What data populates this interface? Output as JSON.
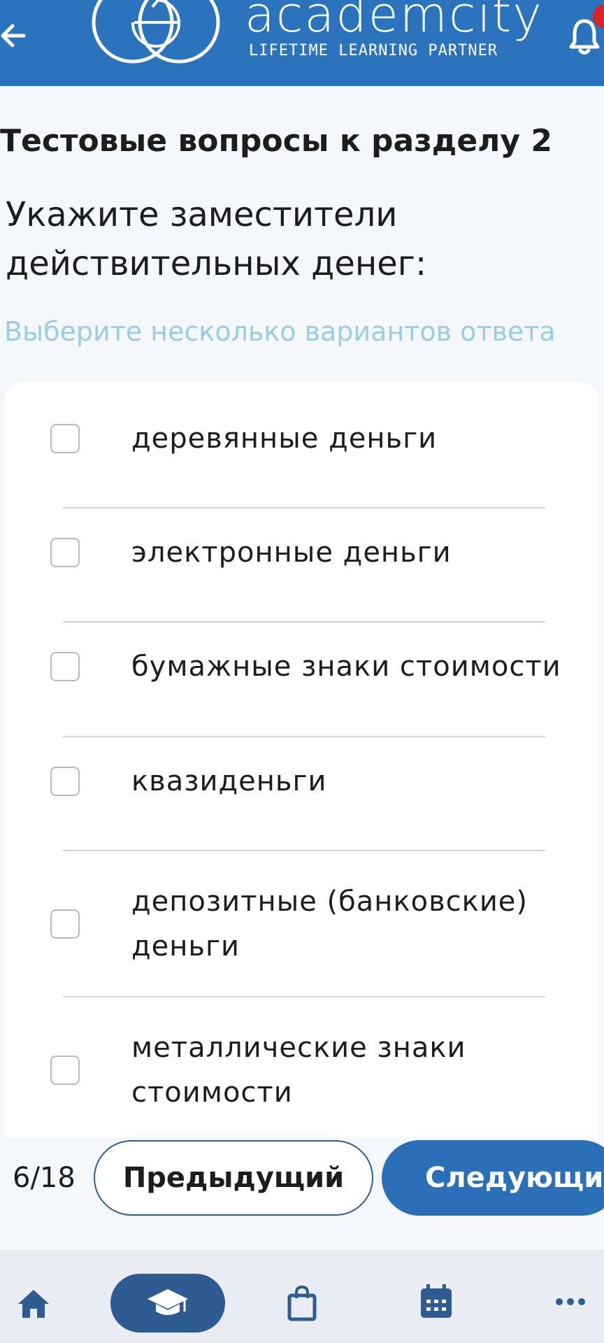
{
  "header": {
    "brand": "academcity",
    "tagline": "LIFETIME LEARNING PARTNER"
  },
  "section_title": "Тестовые вопросы к разделу 2",
  "question": "Укажите заместители действительных денег:",
  "hint": "Выберите несколько вариантов ответа",
  "options": [
    {
      "label": "деревянные деньги",
      "checked": false
    },
    {
      "label": "электронные деньги",
      "checked": false
    },
    {
      "label": "бумажные знаки стоимости",
      "checked": false
    },
    {
      "label": "квазиденьги",
      "checked": false
    },
    {
      "label": "депозитные (банковские) деньги",
      "checked": false
    },
    {
      "label": "металлические знаки стоимости",
      "checked": false
    }
  ],
  "pager": {
    "counter": "6/18",
    "prev_label": "Предыдущий",
    "next_label": "Следующий"
  },
  "bottom_nav": {
    "items": [
      "home-icon",
      "courses-icon",
      "shop-icon",
      "calendar-icon",
      "more-icon"
    ],
    "active": "courses-icon"
  },
  "colors": {
    "accent": "#2b73bd",
    "hint": "#9ccbe4",
    "nav_active": "#2e5b91",
    "badge": "#d8232a"
  }
}
